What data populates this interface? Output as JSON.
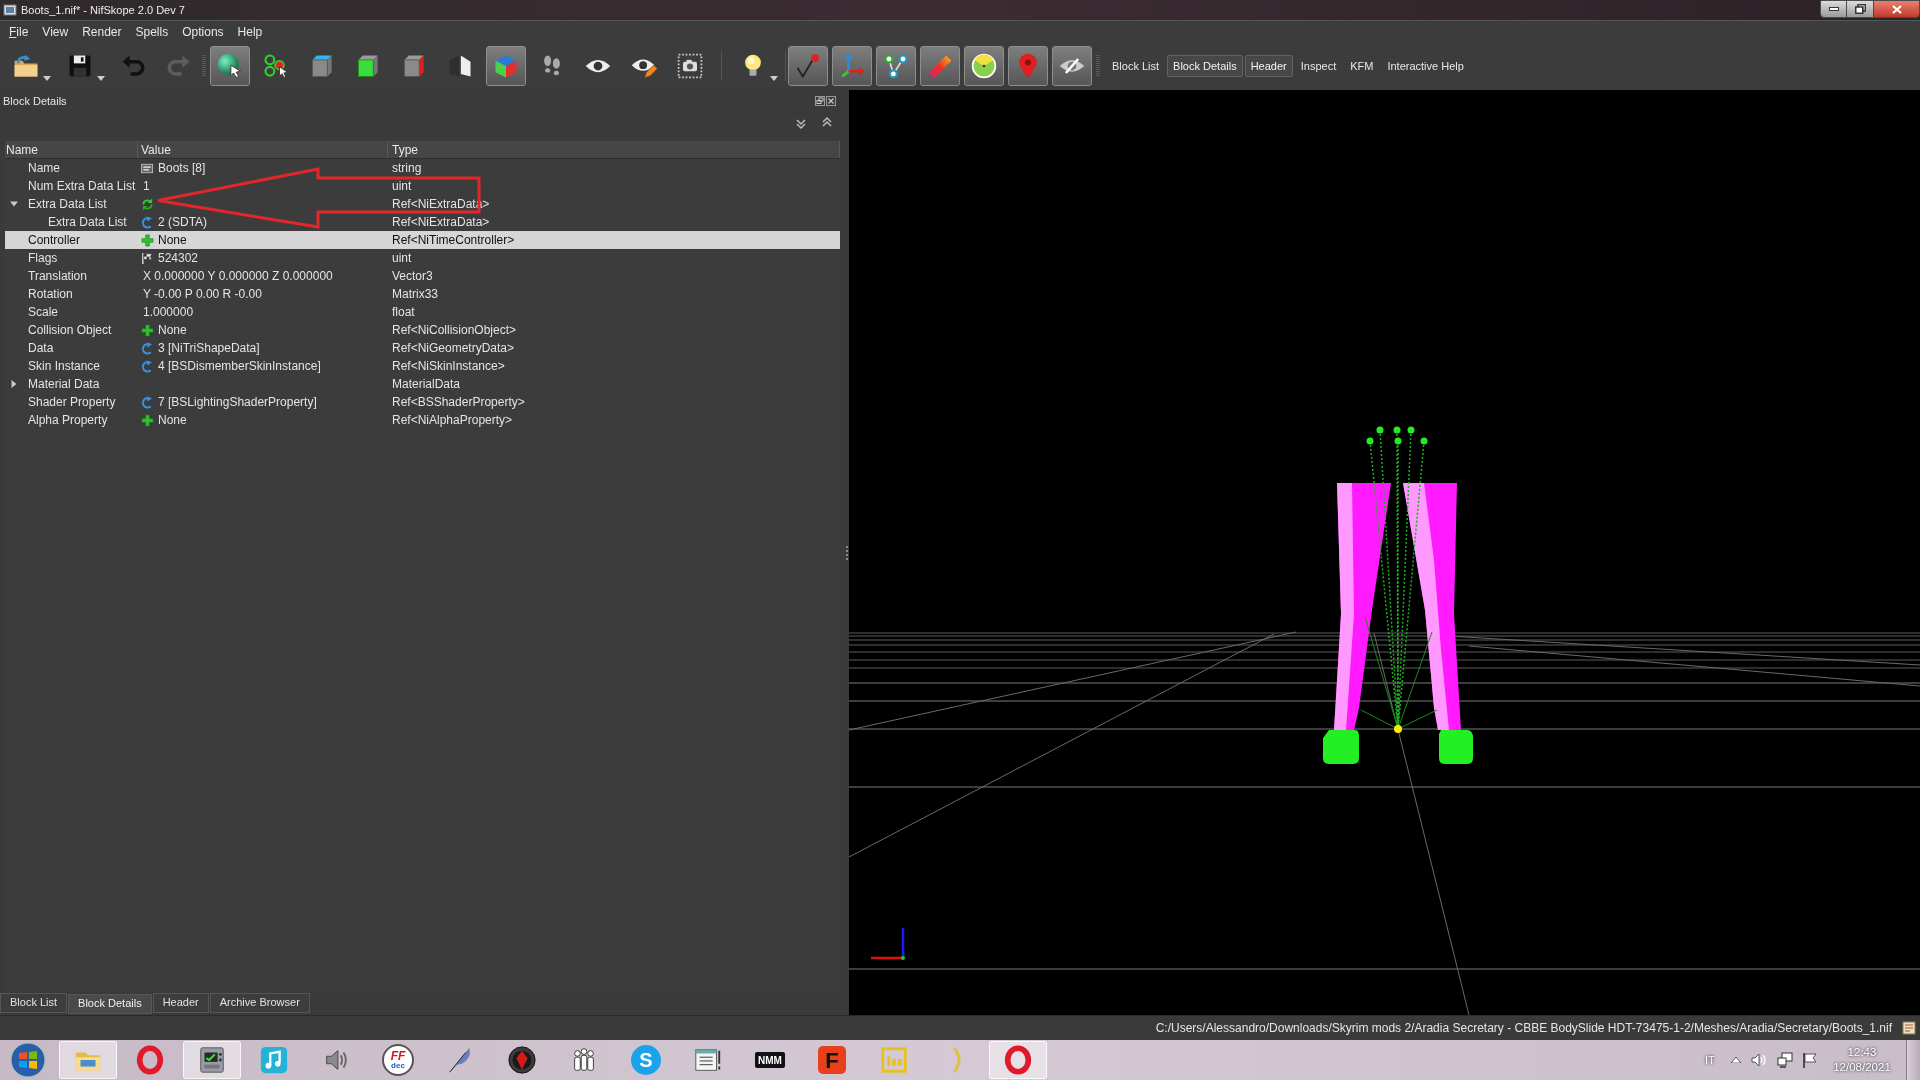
{
  "window": {
    "title": "Boots_1.nif* - NifSkope 2.0 Dev 7"
  },
  "menu": [
    {
      "label": "File",
      "mnemonic": true
    },
    {
      "label": "View",
      "mnemonic": false
    },
    {
      "label": "Render",
      "mnemonic": false
    },
    {
      "label": "Spells",
      "mnemonic": false
    },
    {
      "label": "Options",
      "mnemonic": false
    },
    {
      "label": "Help",
      "mnemonic": false
    }
  ],
  "toolbar": {
    "groups": [
      [
        {
          "kind": "button",
          "disabled": false
        },
        {
          "kind": "button",
          "disabled": false
        },
        {
          "kind": "button",
          "disabled": false
        },
        {
          "kind": "button",
          "disabled": true
        }
      ],
      [
        {
          "kind": "toggle",
          "checked": true,
          "disabled": false
        },
        {
          "kind": "button",
          "disabled": false
        },
        {
          "kind": "button",
          "disabled": false
        },
        {
          "kind": "button",
          "disabled": false
        },
        {
          "kind": "button",
          "disabled": false
        },
        {
          "kind": "button",
          "disabled": false
        },
        {
          "kind": "toggle",
          "checked": true,
          "disabled": false
        },
        {
          "kind": "button",
          "disabled": false
        },
        {
          "kind": "button",
          "disabled": false
        },
        {
          "kind": "button",
          "disabled": false
        },
        {
          "kind": "button",
          "disabled": false
        }
      ],
      [
        {
          "kind": "button",
          "disabled": false
        }
      ],
      [
        {
          "kind": "toggle",
          "checked": true,
          "disabled": false
        },
        {
          "kind": "toggle",
          "checked": true,
          "disabled": false
        },
        {
          "kind": "toggle",
          "checked": true,
          "disabled": false
        },
        {
          "kind": "toggle",
          "checked": true,
          "disabled": false
        },
        {
          "kind": "toggle",
          "checked": true,
          "disabled": false
        },
        {
          "kind": "toggle",
          "checked": true,
          "disabled": false
        },
        {
          "kind": "toggle",
          "checked": true,
          "disabled": false
        }
      ]
    ],
    "views": [
      {
        "label": "Block List",
        "checked": false
      },
      {
        "label": "Block Details",
        "checked": true
      },
      {
        "label": "Header",
        "checked": true
      },
      {
        "label": "Inspect",
        "checked": false
      },
      {
        "label": "KFM",
        "checked": false
      },
      {
        "label": "Interactive Help",
        "checked": false
      }
    ]
  },
  "dock": {
    "title": "Block Details"
  },
  "table": {
    "columns": [
      "Name",
      "Value",
      "Type"
    ],
    "rows": [
      {
        "name": "Name",
        "kind": "text",
        "value": "Boots [8]",
        "type": "string",
        "selected": false
      },
      {
        "name": "Num Extra Data List",
        "kind": "plain",
        "value": "1",
        "type": "uint",
        "selected": false
      },
      {
        "name": "Extra Data List",
        "kind": "array",
        "type": "Ref<NiExtraData>",
        "selected": false,
        "expanded": true,
        "children": [
          {
            "name": "Extra Data List",
            "kind": "link",
            "value": "2 (SDTA)",
            "type": "Ref<NiExtraData>",
            "selected": false
          }
        ]
      },
      {
        "name": "Controller",
        "kind": "empty_link",
        "value": "None",
        "type": "Ref<NiTimeController>",
        "selected": true
      },
      {
        "name": "Flags",
        "kind": "flags",
        "value": "524302",
        "type": "uint",
        "selected": false
      },
      {
        "name": "Translation",
        "kind": "plain",
        "value": "X 0.000000 Y 0.000000 Z 0.000000",
        "type": "Vector3",
        "selected": false
      },
      {
        "name": "Rotation",
        "kind": "plain",
        "value": "Y -0.00 P 0.00 R -0.00",
        "type": "Matrix33",
        "selected": false
      },
      {
        "name": "Scale",
        "kind": "plain",
        "value": "1.000000",
        "type": "float",
        "selected": false
      },
      {
        "name": "Collision Object",
        "kind": "empty_link",
        "value": "None",
        "type": "Ref<NiCollisionObject>",
        "selected": false
      },
      {
        "name": "Data",
        "kind": "link",
        "value": "3 [NiTriShapeData]",
        "type": "Ref<NiGeometryData>",
        "selected": false
      },
      {
        "name": "Skin Instance",
        "kind": "link",
        "value": "4 [BSDismemberSkinInstance]",
        "type": "Ref<NiSkinInstance>",
        "selected": false
      },
      {
        "name": "Material Data",
        "kind": "plain",
        "type": "MaterialData",
        "selected": false,
        "expanded": false
      },
      {
        "name": "Shader Property",
        "kind": "link",
        "value": "7 [BSLightingShaderProperty]",
        "type": "Ref<BSShaderProperty>",
        "selected": false
      },
      {
        "name": "Alpha Property",
        "kind": "empty_link",
        "value": "None",
        "type": "Ref<NiAlphaProperty>",
        "selected": false
      }
    ]
  },
  "bottom_tabs": [
    {
      "label": "Block List",
      "selected": false
    },
    {
      "label": "Block Details",
      "selected": true
    },
    {
      "label": "Header",
      "selected": false
    },
    {
      "label": "Archive Browser",
      "selected": false
    }
  ],
  "status_bar": {
    "path": "C:/Users/Alessandro/Downloads/Skyrim mods 2/Aradia Secretary - CBBE BodySlide HDT-73475-1-2/Meshes/Aradia/Secretary/Boots_1.nif"
  },
  "taskbar": {
    "apps": [
      {
        "active": true
      },
      {
        "active": false
      },
      {
        "active": true
      },
      {
        "active": false
      },
      {
        "active": false
      },
      {
        "active": false,
        "logo_text": [
          "FF",
          "dec"
        ]
      },
      {
        "active": false
      },
      {
        "active": false
      },
      {
        "active": false
      },
      {
        "active": false,
        "logo_text": [
          "S"
        ]
      },
      {
        "active": false
      },
      {
        "active": false,
        "logo_text": [
          "NMM"
        ]
      },
      {
        "active": false,
        "logo_text": [
          "F"
        ]
      },
      {
        "active": false
      },
      {
        "active": false
      },
      {
        "active": true
      }
    ],
    "tray": {
      "language": "IT",
      "time": "12:43",
      "date": "12/08/2021"
    }
  }
}
